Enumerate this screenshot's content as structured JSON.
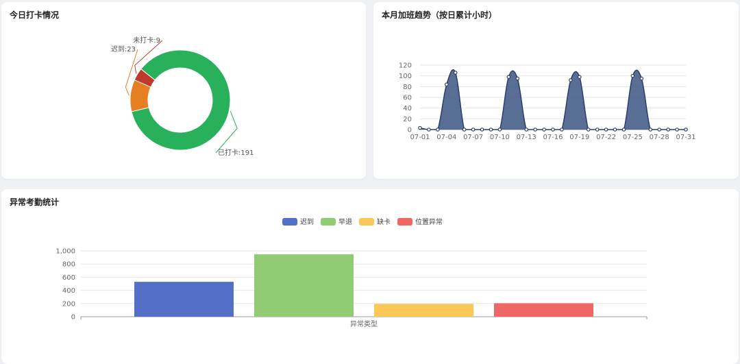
{
  "cards": {
    "today": {
      "title": "今日打卡情况"
    },
    "trend": {
      "title": "本月加班趋势（按日累计小时）"
    },
    "abnormal": {
      "title": "异常考勤统计"
    }
  },
  "chart_data": [
    {
      "type": "pie",
      "slices": [
        {
          "label": "已打卡",
          "display": "已打卡:191",
          "value": 191,
          "color": "#28b05a"
        },
        {
          "label": "迟到",
          "display": "迟到:23",
          "value": 23,
          "color": "#e67e22"
        },
        {
          "label": "未打卡",
          "display": "未打卡:9",
          "value": 9,
          "color": "#c0392b"
        }
      ]
    },
    {
      "type": "area",
      "x_ticks": [
        "07-01",
        "07-04",
        "07-07",
        "07-10",
        "07-13",
        "07-16",
        "07-19",
        "07-22",
        "07-25",
        "07-28",
        "07-31"
      ],
      "ylim": [
        0,
        120
      ],
      "y_ticks": [
        0,
        20,
        40,
        60,
        80,
        100,
        120
      ],
      "color": "#3b5583",
      "x": [
        "07-01",
        "07-02",
        "07-03",
        "07-04",
        "07-05",
        "07-06",
        "07-07",
        "07-08",
        "07-09",
        "07-10",
        "07-11",
        "07-12",
        "07-13",
        "07-14",
        "07-15",
        "07-16",
        "07-17",
        "07-18",
        "07-19",
        "07-20",
        "07-21",
        "07-22",
        "07-23",
        "07-24",
        "07-25",
        "07-26",
        "07-27",
        "07-28",
        "07-29",
        "07-30",
        "07-31"
      ],
      "values": [
        3,
        0,
        0,
        84,
        106,
        0,
        0,
        0,
        0,
        0,
        98,
        95,
        0,
        0,
        0,
        0,
        0,
        92,
        98,
        0,
        0,
        0,
        0,
        0,
        100,
        95,
        0,
        0,
        0,
        0,
        0
      ]
    },
    {
      "type": "bar",
      "categories": [
        "异常类型"
      ],
      "xlabel": "异常类型",
      "ylim": [
        0,
        1000
      ],
      "y_ticks": [
        "0",
        "200",
        "400",
        "600",
        "800",
        "1,000"
      ],
      "series": [
        {
          "name": "迟到",
          "values": [
            530
          ],
          "color": "#5470c6"
        },
        {
          "name": "早退",
          "values": [
            950
          ],
          "color": "#91cc75"
        },
        {
          "name": "缺卡",
          "values": [
            195
          ],
          "color": "#fac858"
        },
        {
          "name": "位置异常",
          "values": [
            205
          ],
          "color": "#ee6666"
        }
      ]
    }
  ]
}
